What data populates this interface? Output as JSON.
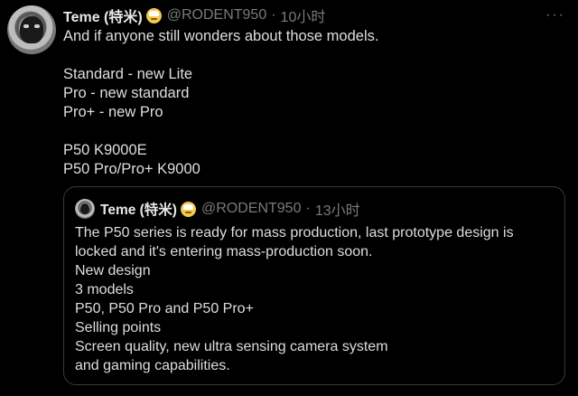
{
  "tweet": {
    "author_name": "Teme (特米)",
    "author_handle": "@RODENT950",
    "separator": "·",
    "time": "10小时",
    "more_label": "···",
    "lines": [
      "And if anyone still wonders about those models.",
      "",
      "Standard - new Lite",
      "Pro - new standard",
      "Pro+ - new Pro",
      "",
      "P50 K9000E",
      "P50 Pro/Pro+ K9000"
    ]
  },
  "quoted_tweet": {
    "author_name": "Teme (特米)",
    "author_handle": "@RODENT950",
    "separator": "·",
    "time": "13小时",
    "lines": [
      "The P50 series is ready for mass production, last prototype design is",
      "locked and it's entering mass-production soon.",
      "New design",
      "3 models",
      "P50, P50 Pro and P50 Pro+",
      "Selling points",
      "Screen quality, new ultra sensing camera system",
      "and gaming capabilities."
    ]
  },
  "colors": {
    "background": "#000000",
    "text": "#dedede",
    "muted": "#7a7a7a",
    "border": "#3a3a3a",
    "emoji": "#f2c94c"
  },
  "icons": {
    "avatar": "avatar",
    "emoji": "grinning-face-icon",
    "more": "more-options-icon"
  }
}
